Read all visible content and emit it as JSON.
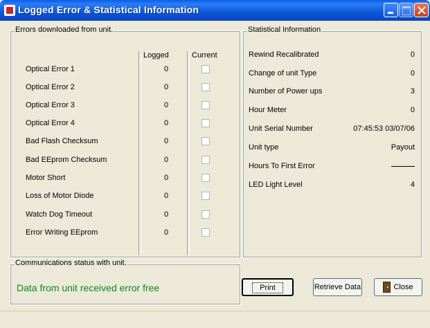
{
  "window": {
    "title": "Logged  Error & Statistical Information"
  },
  "errors_group": {
    "label": "Errors downloaded from unit.",
    "header_logged": "Logged",
    "header_current": "Current",
    "rows": [
      {
        "label": "Optical Error  1",
        "logged": "0",
        "current": false
      },
      {
        "label": "Optical Error  2",
        "logged": "0",
        "current": false
      },
      {
        "label": "Optical Error  3",
        "logged": "0",
        "current": false
      },
      {
        "label": "Optical Error  4",
        "logged": "0",
        "current": false
      },
      {
        "label": "Bad Flash Checksum",
        "logged": "0",
        "current": false
      },
      {
        "label": "Bad EEprom Checksum",
        "logged": "0",
        "current": false
      },
      {
        "label": "Motor Short",
        "logged": "0",
        "current": false
      },
      {
        "label": "Loss of Motor Diode",
        "logged": "0",
        "current": false
      },
      {
        "label": "Watch Dog Timeout",
        "logged": "0",
        "current": false
      },
      {
        "label": "Error Writing EEprom",
        "logged": "0",
        "current": false
      }
    ]
  },
  "stats_group": {
    "label": "Statistical Information",
    "rows": [
      {
        "label": "Rewind Recalibrated",
        "value": "0"
      },
      {
        "label": "Change of unit Type",
        "value": "0"
      },
      {
        "label": "Number of Power ups",
        "value": "3"
      },
      {
        "label": "Hour Meter",
        "value": "0"
      },
      {
        "label": "Unit Serial Number",
        "value": "07:45:53  03/07/06"
      },
      {
        "label": "Unit type",
        "value": "Payout"
      },
      {
        "label": "Hours To First Error",
        "value": ""
      },
      {
        "label": "LED Light Level",
        "value": "4"
      }
    ]
  },
  "comm_group": {
    "label": "Communications status with unit.",
    "status": "Data from unit received error free",
    "status_color": "#0a8a1e"
  },
  "buttons": {
    "print": "Print",
    "retrieve": "Retrieve Data",
    "close": "Close"
  }
}
